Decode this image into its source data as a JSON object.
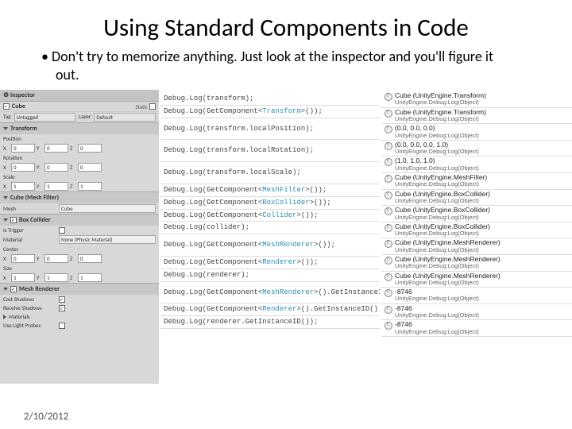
{
  "slide": {
    "title": "Using Standard Components in Code",
    "bullet": "Don't try to memorize anything. Just look at the inspector and you'll figure it out.",
    "date": "2/10/2012"
  },
  "inspector": {
    "header": "Inspector",
    "name": "Cube",
    "static": "Static",
    "tag": "Untagged",
    "layer": "Default",
    "transform": {
      "title": "Transform",
      "position": {
        "label": "Position",
        "x": "0",
        "y": "0",
        "z": "0"
      },
      "rotation": {
        "label": "Rotation",
        "x": "0",
        "y": "0",
        "z": "0"
      },
      "scale": {
        "label": "Scale",
        "x": "1",
        "y": "1",
        "z": "1"
      }
    },
    "mesh_filter": {
      "title": "Cube (Mesh Filter)",
      "mesh_label": "Mesh",
      "mesh_value": "Cube"
    },
    "box_collider": {
      "title": "Box Collider",
      "is_trigger": "Is Trigger",
      "material_label": "Material",
      "material_value": "None (Physic Material)",
      "center": {
        "label": "Center",
        "x": "0",
        "y": "0",
        "z": "0"
      },
      "size": {
        "label": "Size",
        "x": "1",
        "y": "1",
        "z": "1"
      }
    },
    "mesh_renderer": {
      "title": "Mesh Renderer",
      "cast": "Cast Shadows",
      "receive": "Receive Shadows",
      "materials": "Materials",
      "probes": "Use Light Probes"
    }
  },
  "code": {
    "l0": "Debug.Log(transform);",
    "l1a": "Debug.Log(GetComponent<",
    "l1b": "Transform",
    "l1c": ">());",
    "l2": "Debug.Log(transform.localPosition);",
    "l3": "Debug.Log(transform.localRotation);",
    "l4": "Debug.Log(transform.localScale);",
    "l5a": "Debug.Log(GetComponent<",
    "l5b": "MeshFilter",
    "l5c": ">());",
    "l6a": "Debug.Log(GetComponent<",
    "l6b": "BoxCollider",
    "l6c": ">());",
    "l7a": "Debug.Log(GetComponent<",
    "l7b": "Collider",
    "l7c": ">());",
    "l8": "Debug.Log(collider);",
    "l9a": "Debug.Log(GetComponent<",
    "l9b": "MeshRenderer",
    "l9c": ">());",
    "l10a": "Debug.Log(GetComponent<",
    "l10b": "Renderer",
    "l10c": ">());",
    "l11": "Debug.Log(renderer);",
    "l12a": "Debug.Log(GetComponent<",
    "l12b": "MeshRenderer",
    "l12c": ">().GetInstanceID());",
    "l13a": "Debug.Log(GetComponent<",
    "l13b": "Renderer",
    "l13c": ">().GetInstanceID());",
    "l14": "Debug.Log(renderer.GetInstanceID());"
  },
  "log": {
    "sub": "UnityEngine.Debug:Log(Object)",
    "r0": "Cube (UnityEngine.Transform)",
    "r1": "Cube (UnityEngine.Transform)",
    "r2": "(0.0, 0.0, 0.0)",
    "r3": "(0.0, 0.0, 0.0, 1.0)",
    "r4": "(1.0, 1.0, 1.0)",
    "r5": "Cube (UnityEngine.MeshFilter)",
    "r6": "Cube (UnityEngine.BoxCollider)",
    "r7": "Cube (UnityEngine.BoxCollider)",
    "r8": "Cube (UnityEngine.BoxCollider)",
    "r9": "Cube (UnityEngine.MeshRenderer)",
    "r10": "Cube (UnityEngine.MeshRenderer)",
    "r11": "Cube (UnityEngine.MeshRenderer)",
    "r12": "-8746",
    "r13": "-8746",
    "r14": "-8746"
  }
}
